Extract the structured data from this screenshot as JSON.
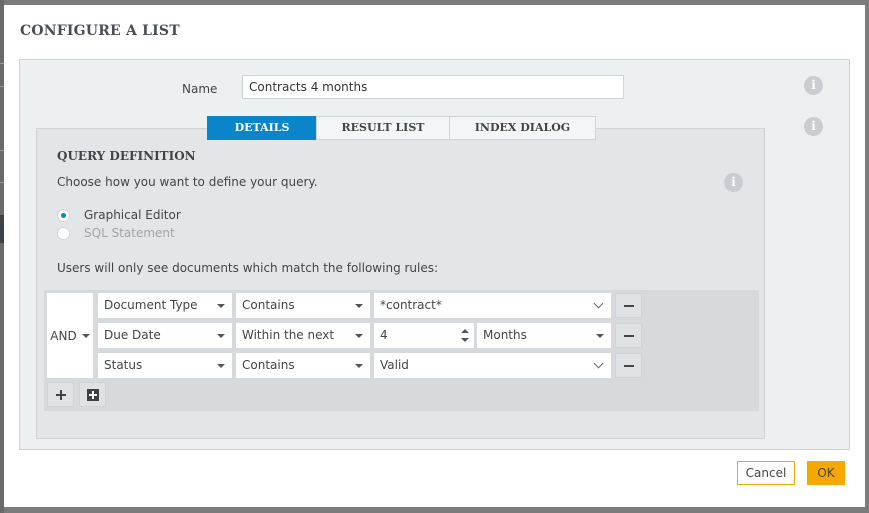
{
  "dialog": {
    "title": "CONFIGURE A LIST",
    "name_label": "Name",
    "name_value": "Contracts 4 months",
    "info_icon": "info-icon",
    "tabs": [
      {
        "label": "DETAILS",
        "active": true
      },
      {
        "label": "RESULT LIST",
        "active": false
      },
      {
        "label": "INDEX DIALOG",
        "active": false
      }
    ],
    "query": {
      "title": "QUERY DEFINITION",
      "description": "Choose how you want to define your query.",
      "options": [
        {
          "label": "Graphical Editor",
          "checked": true,
          "disabled": false
        },
        {
          "label": "SQL Statement",
          "checked": false,
          "disabled": true
        }
      ],
      "rules_description": "Users will only see documents which match the following rules:",
      "operator": "AND",
      "rules": [
        {
          "field": "Document Type",
          "condition": "Contains",
          "value": "*contract*"
        },
        {
          "field": "Due Date",
          "condition": "Within the next",
          "value": "4",
          "unit": "Months"
        },
        {
          "field": "Status",
          "condition": "Contains",
          "value": "Valid"
        }
      ],
      "add_rule_icon": "plus-icon",
      "add_group_icon": "plus-square-icon",
      "remove_rule_icon": "minus-icon"
    },
    "buttons": {
      "cancel": "Cancel",
      "ok": "OK"
    },
    "colors": {
      "accent": "#0a85c9",
      "primary_button": "#f7a800"
    }
  }
}
